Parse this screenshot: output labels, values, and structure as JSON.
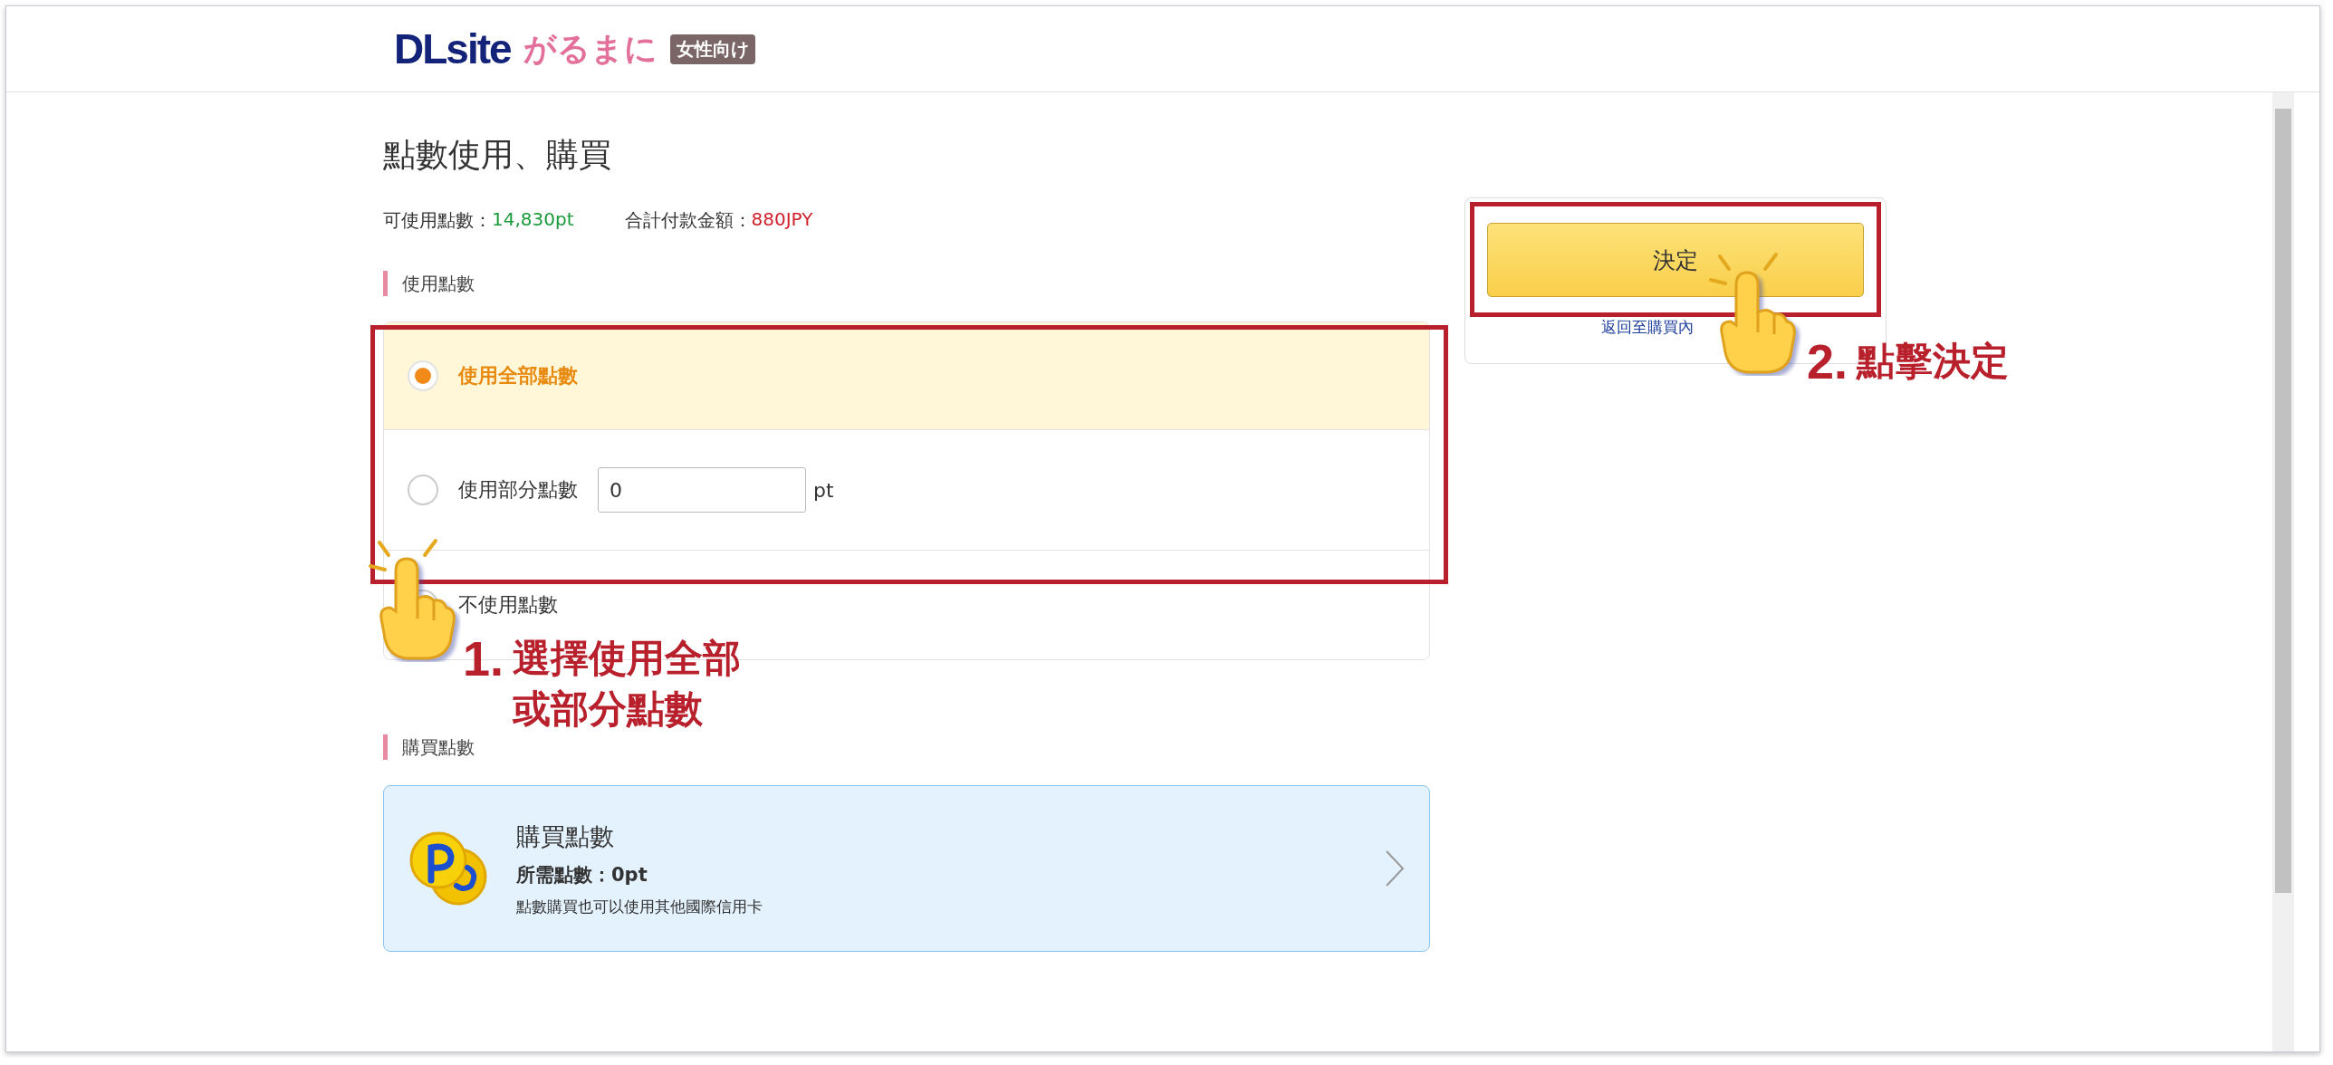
{
  "logo": {
    "brand": "DLsite",
    "name": "がるまに",
    "tag": "女性向け"
  },
  "title": "點數使用、購買",
  "summary": [
    {
      "kind": "available",
      "label": "可使用點數：",
      "value": "14,830pt"
    },
    {
      "kind": "total",
      "label": "合計付款金額：",
      "value": "880JPY"
    }
  ],
  "use_section": {
    "heading": "使用點數",
    "options": [
      {
        "label": "使用全部點數",
        "selected": true
      },
      {
        "label": "使用部分點數",
        "selected": false,
        "input": {
          "value": "0",
          "unit": "pt"
        }
      },
      {
        "label": "不使用點數",
        "selected": false
      }
    ]
  },
  "buy_section": {
    "heading": "購買點數",
    "card": {
      "title": "購買點數",
      "required": "所需點數：0pt",
      "note": "點數購買也可以使用其他國際信用卡"
    }
  },
  "side": {
    "button": "決定",
    "link": "返回至購買內"
  },
  "annotations": [
    {
      "step": "1.",
      "lines": [
        "選擇使用全部",
        "或部分點數"
      ]
    },
    {
      "step": "2.",
      "lines": [
        "點擊決定"
      ]
    }
  ]
}
